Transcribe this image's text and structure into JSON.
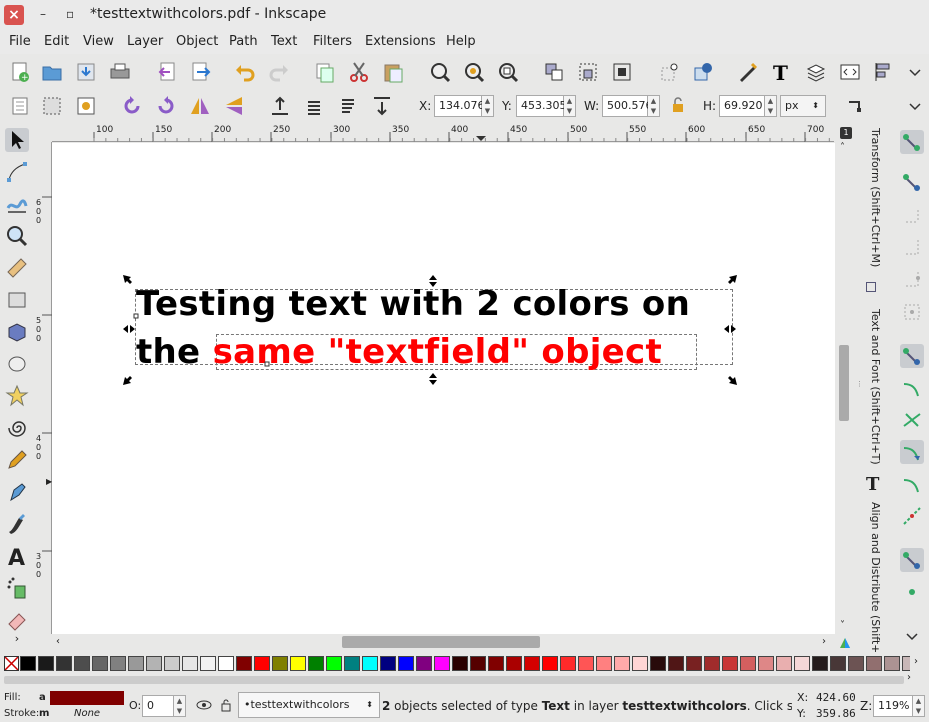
{
  "window": {
    "title": "*testtextwithcolors.pdf - Inkscape",
    "close_glyph": "×",
    "controls": [
      "–",
      "▫"
    ]
  },
  "menu": [
    "File",
    "Edit",
    "View",
    "Layer",
    "Object",
    "Path",
    "Text",
    "Filters",
    "Extensions",
    "Help"
  ],
  "toolbar": {
    "main_icons": [
      "new-document-icon",
      "open-icon",
      "save-icon",
      "print-icon",
      "import-icon",
      "export-icon",
      "undo-icon",
      "redo-icon",
      "duplicate-icon",
      "cut-icon",
      "paste-icon",
      "zoom-selection-icon",
      "zoom-drawing-icon",
      "zoom-page-icon",
      "group-icon",
      "ungroup-icon",
      "clone-icon",
      "node-icon",
      "xml-editor-icon",
      "text-tool-icon",
      "layers-icon",
      "align-icon",
      "preferences-icon"
    ]
  },
  "selectbar": {
    "x_label": "X:",
    "x_value": "134.076",
    "y_label": "Y:",
    "y_value": "453.305",
    "w_label": "W:",
    "w_value": "500.576",
    "h_label": "H:",
    "h_value": "69.920",
    "unit": "px"
  },
  "ruler_top": [
    "100",
    "150",
    "200",
    "250",
    "300",
    "350",
    "400",
    "450",
    "500",
    "550",
    "600",
    "650",
    "700"
  ],
  "ruler_left": [
    [
      "6",
      "0",
      "0"
    ],
    [
      "5",
      "0",
      "0"
    ],
    [
      "4",
      "0",
      "0"
    ],
    [
      "3",
      "0",
      "0"
    ]
  ],
  "canvas": {
    "line1": "Testing text with 2 colors on",
    "line2_black": "the ",
    "line2_red": "same \"textfield\" object"
  },
  "dock_labels": [
    "Transform (Shift+Ctrl+M)",
    "Text and Font (Shift+Ctrl+T)",
    "Align and Distribute (Shift+Ctrl+A)"
  ],
  "palette_colors": [
    "#000000",
    "#1a1a1a",
    "#333333",
    "#4d4d4d",
    "#666666",
    "#808080",
    "#999999",
    "#b3b3b3",
    "#cccccc",
    "#e6e6e6",
    "#f2f2f2",
    "#ffffff",
    "#800000",
    "#ff0000",
    "#808000",
    "#ffff00",
    "#008000",
    "#00ff00",
    "#008080",
    "#00ffff",
    "#000080",
    "#0000ff",
    "#800080",
    "#ff00ff",
    "#2b0000",
    "#550000",
    "#800000",
    "#aa0000",
    "#d40000",
    "#ff0000",
    "#ff2a2a",
    "#ff5555",
    "#ff8080",
    "#ffaaaa",
    "#ffd5d5",
    "#280b0b",
    "#501616",
    "#782121",
    "#a02c2c",
    "#c83737",
    "#d35f5f",
    "#de8787",
    "#e9afaf",
    "#f4d7d7",
    "#241c1c",
    "#483737",
    "#6c5353",
    "#916f6f",
    "#ac9393",
    "#c8b7b7",
    "#e3dbdb"
  ],
  "status": {
    "fill_label": "Fill:",
    "fill_value": "a",
    "fill_color": "#800000",
    "stroke_label": "Stroke:",
    "stroke_value": "m",
    "stroke_none": "None",
    "opacity_label": "O:",
    "opacity_value": "0",
    "layer": "•testtextwithcolors",
    "message_count": "2",
    "message_1": " objects selected of type ",
    "message_type": "Text",
    "message_2": " in layer ",
    "message_layer": "testtextwithcolors",
    "message_3": ". Click sele...",
    "x_label": "X:",
    "x_value": "424.60",
    "y_label": "Y:",
    "y_value": "359.86",
    "z_label": "Z:",
    "zoom": "119%"
  }
}
